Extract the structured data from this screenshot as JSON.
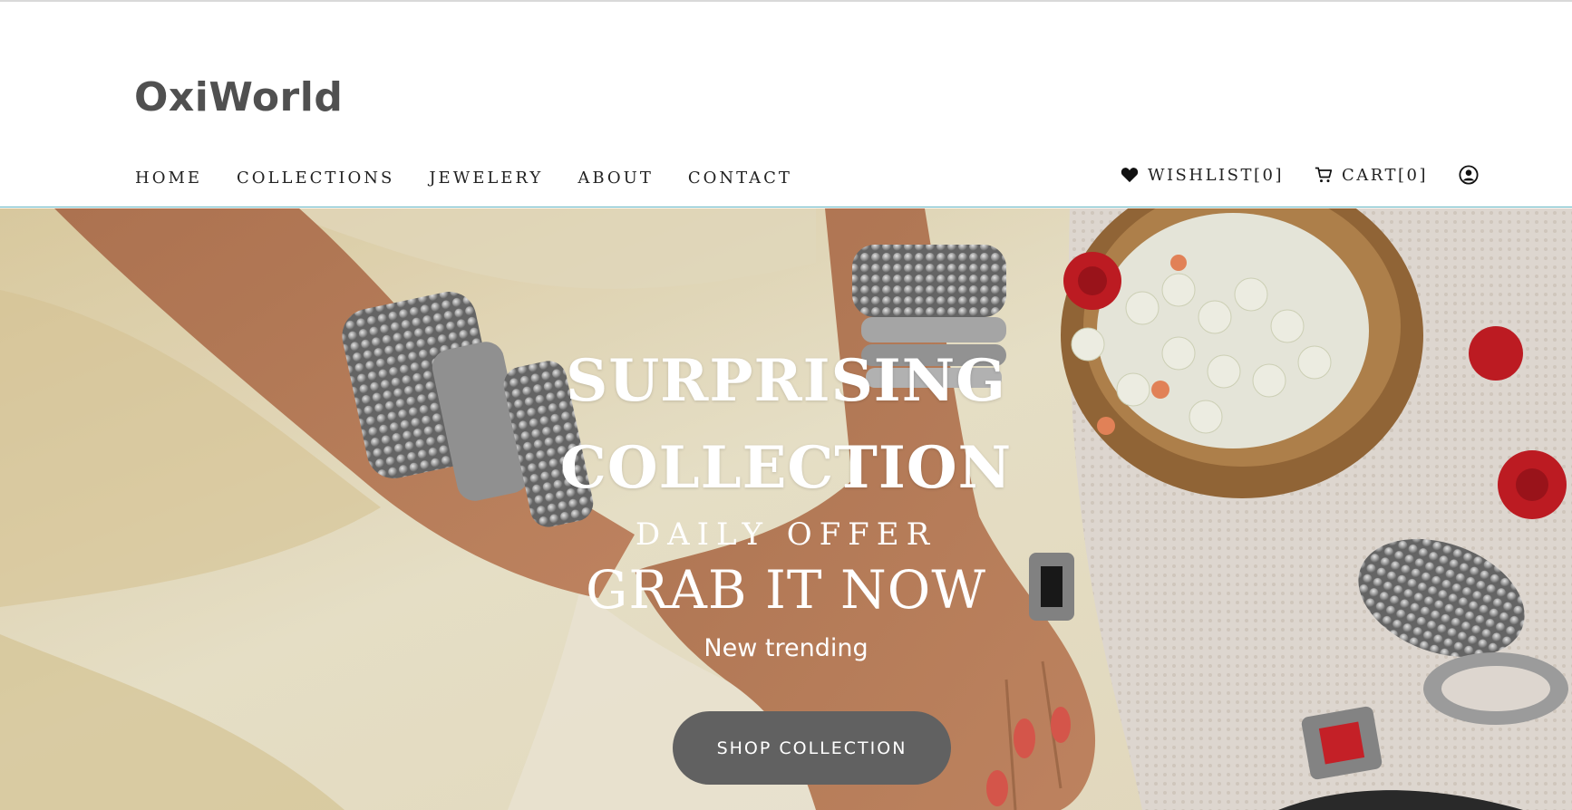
{
  "brand": {
    "logo": "OxiWorld"
  },
  "nav": {
    "items": [
      {
        "label": "HOME"
      },
      {
        "label": "COLLECTIONS"
      },
      {
        "label": "JEWELERY"
      },
      {
        "label": "ABOUT"
      },
      {
        "label": "CONTACT"
      }
    ]
  },
  "actions": {
    "wishlist_label": "WISHLIST",
    "wishlist_count": "[0]",
    "cart_label": "CART",
    "cart_count": "[0]",
    "icons": [
      "heart-icon",
      "cart-icon",
      "user-account-icon"
    ]
  },
  "hero": {
    "title_line1": "SURPRISING",
    "title_line2": "COLLECTION",
    "offer": "DAILY OFFER",
    "grab": "GRAB IT NOW",
    "subtitle": "New trending",
    "button_label": "SHOP COLLECTION"
  },
  "colors": {
    "logo": "#505050",
    "button": "#616161",
    "header_border": "#5fb3bf",
    "hero_text": "#ffffff"
  }
}
